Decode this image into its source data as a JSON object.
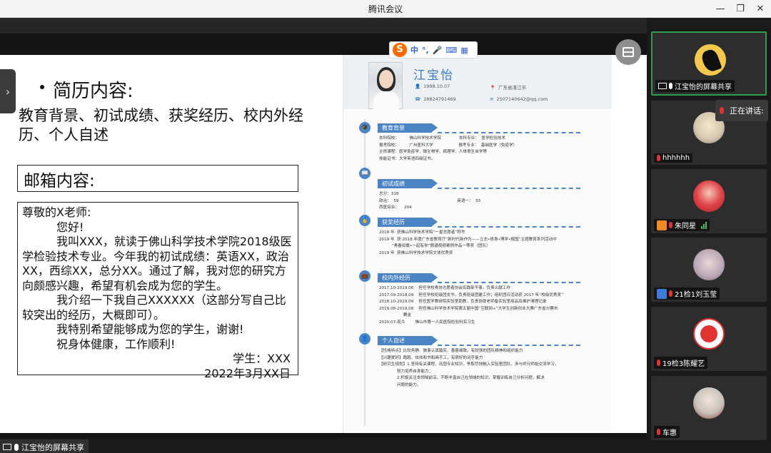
{
  "window": {
    "title": "腾讯会议"
  },
  "slide": {
    "heading": "简历内容:",
    "body": "教育背景、初试成绩、获奖经历、校内外经历、个人自述",
    "mail_title": "邮箱内容:",
    "letter": {
      "greeting": "尊敬的X老师:",
      "hello": "您好!",
      "p1": "我叫XXX，就读于佛山科学技术学院2018级医学检验技术专业。今年我的初试成绩：英语XX，政治XX，西综XX，总分XX。通过了解，我对您的研究方向颇感兴趣，希望有机会成为您的学生。",
      "p2": "我介绍一下我自己XXXXXX（这部分写自己比较突出的经历，大概即可）。",
      "p3": "我特别希望能够成为您的学生，谢谢!",
      "p4": "祝身体健康，工作顺利!",
      "sign": "学生：XXX",
      "date": "2022年3月XX日"
    }
  },
  "resume": {
    "name": "江宝怡",
    "birth": "1998.10.07",
    "place": "广东省湛江市",
    "phone": "18824791469",
    "email": "2507140642@qq.com",
    "sections": {
      "edu": "教育背景",
      "score": "初试成绩",
      "award": "获奖经历",
      "campus": "校内外经历",
      "self": "个人自述"
    },
    "edu_lines": [
      "本科院校：        佛山科学技术学院              本科专业：  医学检验技术",
      "报考院校：        广州医科大学                    报考专业：  基础医学（免疫学）",
      "主修课程：医学免疫学、微生物学、病理学、人体寄生虫学等",
      "技能证书：大学英语四级证书。"
    ],
    "score_lines": [
      "总分：318",
      "政治：  59                                              英语一：  55",
      "西医综合：    204"
    ],
    "award_lines": [
      "2018 年  获佛山科学技术学院“一星志愿者”称号",
      "2019 年  获 2018 年度广东省教育厅“新时代新作为——立志•修身•博学•报国”主题教育系列活动中",
      "          “青春如歌•一起有你”朗诵视频案例作品一等奖（团队）",
      "2019 年  获佛山科学技术学院文体优秀奖"
    ],
    "campus_lines": [
      "2017.10-2019.06    担任学校青协志愿者协会实践部干事，负责义献工作",
      "2017.09-2018.09    担任学校班级团支书，负责班级团建工作；组织团日活动获 2017 年“校级优秀奖”",
      "2018.10-2019.09    担任医学教研院实验室助教，负责协助老师备实验室用品及维护清理记录",
      "2019.08-2019.08    担任佛山科学技术学院第五届中国“互联网+”大学生创新创业大赛广东省分赛市",
      "                   赛金",
      "2020.07-现今        佛山市第一人民医院检验科实习生"
    ],
    "self_lines": [
      "【性格特点】比较务静、做事认真踏实、善善细致，有较强的团队精神和组织能力",
      "【兴趣爱好】跑跑、炫炫和书和画手工，有很好的动手能力",
      "【研究生规划】1.坚持有关课程、巩固专业知识，争取尽快融入实验室团队、多与师兄师姐交流学习，",
      "              努力培养自身能力；",
      "              2.积极关注本领域前沿、不断丰富自己在领域的知识，掌握训练自己分析问题，解决",
      "              问题的能力。"
    ]
  },
  "ime": {
    "logo": "S",
    "lang": "中",
    "punct": "°,",
    "mic": "🎤",
    "kbd": "⌨",
    "grid": "▦"
  },
  "share": {
    "label": "江宝怡的屏幕共享"
  },
  "speaking": {
    "label": "正在讲话:"
  },
  "participants": [
    {
      "name": "江宝怡的屏幕共享",
      "color": "#f2c94c"
    },
    {
      "name": "hhhhhh",
      "color": "#d7c9b2"
    },
    {
      "name": "朱同星",
      "color": "#e0454a"
    },
    {
      "name": "21检1刘玉莹",
      "color": "#b9a6b4"
    },
    {
      "name": "19检3陈耀艺",
      "color": "#e23232"
    },
    {
      "name": "车惠",
      "color": "#c8c2bc"
    }
  ]
}
